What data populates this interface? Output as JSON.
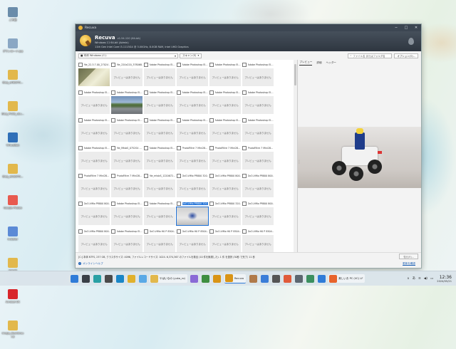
{
  "desktop": {
    "icons": [
      {
        "label": "ごみ箱",
        "icon": "recycle-bin-icon",
        "color": "#6a8caa"
      },
      {
        "label": "ダウンロード.jpg",
        "icon": "image-file-icon",
        "color": "#8aa7c4"
      },
      {
        "label": "Blog_e46S5TA…",
        "icon": "folder-icon",
        "color": "#e2b84c"
      },
      {
        "label": "Blog_PC5B_ubu…",
        "icon": "folder-icon",
        "color": "#e2b84c"
      },
      {
        "label": "VirtualBox",
        "icon": "virtualbox-icon",
        "color": "#2f6fb8"
      },
      {
        "label": "Blog_e53S5TA…",
        "icon": "folder-icon",
        "color": "#e2b84c"
      },
      {
        "label": "Google Photos",
        "icon": "photos-icon",
        "color": "#e85a4f"
      },
      {
        "label": "Installer",
        "icon": "installer-icon",
        "color": "#5b8ad6"
      },
      {
        "label": "bizsoft",
        "icon": "folder-icon",
        "color": "#e2b84c"
      },
      {
        "label": "Acrobat DC",
        "icon": "acrobat-icon",
        "color": "#d8262b"
      },
      {
        "label": "Image_BackGround",
        "icon": "folder-icon",
        "color": "#e2b84c"
      }
    ]
  },
  "window": {
    "title": "Recuva",
    "app_name": "Recuva",
    "version": "v1.54.120 (64-bit)",
    "sys_line1": "Windows 11 64-bit (Admin)",
    "sys_line2": "11th Gen Intel Core i3-1115G4 @ 3.00GHz, 8.0GB RAM, Intel UHD Graphics",
    "controls": {
      "minimize": "─",
      "maximize": "□",
      "close": "✕"
    }
  },
  "toolbar": {
    "drive": "■ 本体 Windows (C:)",
    "drive_arrow": "▾",
    "scan": "スキャン(S)",
    "scan_arrow": "▾",
    "search_placeholder": "ファイル名 またはフォルダ名",
    "options": "オプション(O)..."
  },
  "grid": {
    "no_preview": "プレビューはありません",
    "tiles": [
      {
        "name": "file_22.3.7.00_27024 ...",
        "thumb": "photo-paper"
      },
      {
        "name": "file_220x220_378068...",
        "thumb": "none"
      },
      {
        "name": "Adobe Photoshop El...",
        "thumb": "none"
      },
      {
        "name": "Adobe Photoshop El...",
        "thumb": "none"
      },
      {
        "name": "Adobe Photoshop El...",
        "thumb": "none"
      },
      {
        "name": "Adobe Photoshop El...",
        "thumb": "none"
      },
      {
        "name": "Adobe Photoshop El...",
        "thumb": "none"
      },
      {
        "name": "Adobe Photoshop El...",
        "thumb": "photo-road"
      },
      {
        "name": "Adobe Photoshop El...",
        "thumb": "none"
      },
      {
        "name": "Adobe Photoshop El...",
        "thumb": "none"
      },
      {
        "name": "Adobe Photoshop El...",
        "thumb": "none"
      },
      {
        "name": "Adobe Photoshop El...",
        "thumb": "none"
      },
      {
        "name": "Adobe Photoshop El...",
        "thumb": "none"
      },
      {
        "name": "Adobe Photoshop El...",
        "thumb": "none"
      },
      {
        "name": "Adobe Photoshop El...",
        "thumb": "none"
      },
      {
        "name": "Adobe Photoshop El...",
        "thumb": "none"
      },
      {
        "name": "Adobe Photoshop El...",
        "thumb": "none"
      },
      {
        "name": "Adobe Photoshop El...",
        "thumb": "none"
      },
      {
        "name": "Adobe Photoshop El...",
        "thumb": "none"
      },
      {
        "name": "file_MtsbS_0752S4 ...",
        "thumb": "none"
      },
      {
        "name": "Adobe Photoshop El...",
        "thumb": "none"
      },
      {
        "name": "PhotoFiltre 7 Mini28...",
        "thumb": "none"
      },
      {
        "name": "PhotoFiltre 7 Mini28...",
        "thumb": "none"
      },
      {
        "name": "PhotoFiltre 7 Mini28...",
        "thumb": "none"
      },
      {
        "name": "PhotoFiltre 7 Mini28...",
        "thumb": "none"
      },
      {
        "name": "PhotoFiltre 7 Mini28...",
        "thumb": "none"
      },
      {
        "name": "file_mtsbS_1220672...",
        "thumb": "none"
      },
      {
        "name": "DxO-ViMo PR800 320...",
        "thumb": "none"
      },
      {
        "name": "DxO-ViMo PR800 800...",
        "thumb": "none"
      },
      {
        "name": "DxO-ViMo PR800 800...",
        "thumb": "none"
      },
      {
        "name": "DxO-ViMo PR800 800...",
        "thumb": "none"
      },
      {
        "name": "Adobe Photoshop El...",
        "thumb": "none"
      },
      {
        "name": "Adobe Photoshop El...",
        "thumb": "none"
      },
      {
        "name": "DxO-ViMo PR800 320...",
        "thumb": "photo-lego",
        "selected": true
      },
      {
        "name": "DxO-ViMo PR800 320...",
        "thumb": "none"
      },
      {
        "name": "DxO-ViMo PR800 800...",
        "thumb": "none"
      },
      {
        "name": "DxO-ViMo PR800 800...",
        "thumb": "none"
      },
      {
        "name": "Adobe Photoshop El...",
        "thumb": "none"
      },
      {
        "name": "DxO-ViMo H0 P 8504...",
        "thumb": "none"
      },
      {
        "name": "DxO-ViMo H0 P 8504...",
        "thumb": "none"
      },
      {
        "name": "DxO-ViMo H0 P 8504...",
        "thumb": "none"
      },
      {
        "name": "DxO-ViMo H0 P 8504...",
        "thumb": "none"
      }
    ]
  },
  "preview": {
    "tabs": [
      "プレビュー",
      "詳細",
      "ヘッダー"
    ],
    "active_tab": 0
  },
  "status": {
    "text": "[C:] 本体 NTFS, 237 GB, クラスタサイズ: 4096, ファイルレコードサイズ: 1024. 6,374,367 のファイルを検出 (10 件を無視した). 1 件 を選択 (30秒 で完了) 11 秒",
    "recover_label": "復元(R)..."
  },
  "footer": {
    "help_label": "オンラインヘルプ",
    "update_label": "更新を確認"
  },
  "taskbar": {
    "apps": [
      {
        "label": "",
        "icon": "windows-start-icon",
        "color": "#2f7bd8"
      },
      {
        "label": "",
        "icon": "task-view-icon",
        "color": "#3a3f47"
      },
      {
        "label": "",
        "icon": "vpn-icon",
        "color": "#2aa0a4"
      },
      {
        "label": "",
        "icon": "cursor-icon",
        "color": "#4a4a4a"
      },
      {
        "label": "",
        "icon": "edge-icon",
        "color": "#1a86c7"
      },
      {
        "label": "",
        "icon": "chrome-icon",
        "color": "#e1b12c"
      },
      {
        "label": "",
        "icon": "cloud-icon",
        "color": "#5aa9e6"
      },
      {
        "label": "やばいなの (yuka_ro)",
        "icon": "gallery-icon",
        "color": "#e2b84c"
      },
      {
        "label": "",
        "icon": "paint-icon",
        "color": "#8a6ad6"
      },
      {
        "label": "",
        "icon": "app-icon",
        "color": "#3e8e41"
      },
      {
        "label": "",
        "icon": "recuva-icon",
        "color": "#d99416"
      },
      {
        "label": "Recuva",
        "icon": "recuva-taskbar-icon",
        "color": "#d99416",
        "active": true
      },
      {
        "label": "",
        "icon": "person-icon",
        "color": "#b07a4a"
      },
      {
        "label": "",
        "icon": "photo-viewer-icon",
        "color": "#3b7dd8"
      },
      {
        "label": "",
        "icon": "recorder-icon",
        "color": "#555555"
      },
      {
        "label": "",
        "icon": "rocket-icon",
        "color": "#e05a3a"
      },
      {
        "label": "",
        "icon": "settings-icon",
        "color": "#5c6670"
      },
      {
        "label": "",
        "icon": "browser-icon",
        "color": "#3b8f5f"
      },
      {
        "label": "",
        "icon": "mail-icon",
        "color": "#2f7bd8"
      },
      {
        "label": "美しいお PC (VC) LF",
        "icon": "firefox-icon",
        "color": "#e8632b"
      }
    ],
    "tray": {
      "chevron": "∧",
      "lang": "あ",
      "wifi": "≋",
      "volume": "◀)",
      "battery": "▭"
    },
    "clock_time": "12:36",
    "clock_date": "2024/05/21"
  }
}
